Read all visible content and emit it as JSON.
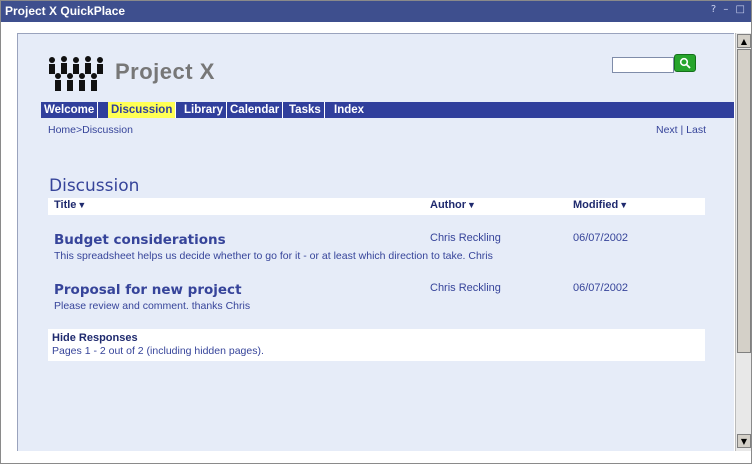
{
  "window": {
    "title": "Project X QuickPlace",
    "controls": "? – □"
  },
  "header": {
    "brand": "Project X"
  },
  "search": {
    "value": "",
    "placeholder": ""
  },
  "nav": {
    "items": [
      {
        "label": "Welcome"
      },
      {
        "label": "Discussion",
        "active": true
      },
      {
        "label": "Library"
      },
      {
        "label": "Calendar"
      },
      {
        "label": "Tasks"
      },
      {
        "label": "Index"
      }
    ]
  },
  "breadcrumb": "Home>Discussion",
  "pager": "Next | Last",
  "main": {
    "title": "Discussion",
    "columns": {
      "title": "Title",
      "author": "Author",
      "modified": "Modified"
    },
    "rows": [
      {
        "subject": "Budget considerations",
        "summary": "This spreadsheet helps us decide whether to go for it - or at least which direction to take. Chris",
        "author": "Chris Reckling",
        "modified": "06/07/2002"
      },
      {
        "subject": "Proposal for new project",
        "summary": "Please review and comment. thanks Chris",
        "author": "Chris Reckling",
        "modified": "06/07/2002"
      }
    ],
    "footer": {
      "hide_responses": "Hide Responses",
      "pages": "Pages 1 - 2 out of 2 (including hidden pages)."
    }
  },
  "icons": {
    "logo": "people-logo-icon",
    "search": "search-icon",
    "sort": "sort-down-icon",
    "scroll_up": "scroll-up-icon",
    "scroll_down": "scroll-down-icon"
  },
  "colors": {
    "titlebar": "#3e4f8e",
    "navbar": "#303f9c",
    "nav_active": "#ffff55",
    "content_bg": "#e6ecf8",
    "text": "#36449a",
    "search_button": "#27a52c"
  }
}
